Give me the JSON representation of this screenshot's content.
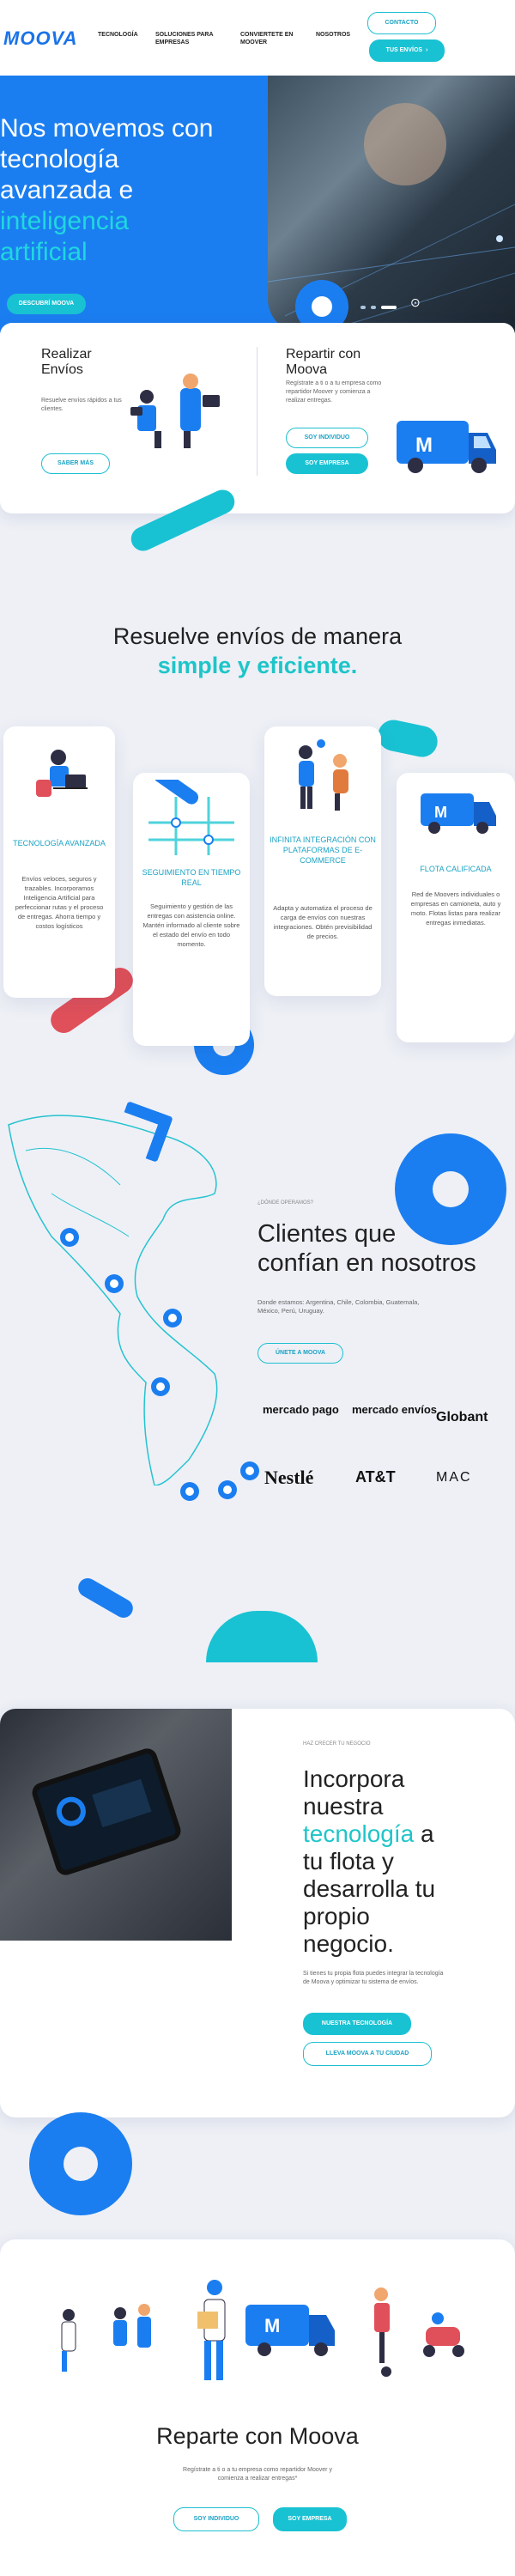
{
  "header": {
    "logo": "MOOVA",
    "nav": [
      "TECNOLOGÍA",
      "SOLUCIONES PARA EMPRESAS",
      "CONVIERTETE EN MOOVER",
      "NOSOTROS"
    ],
    "contact_label": "CONTACTO",
    "send_label": "TUS ENVÍOS"
  },
  "hero": {
    "title_line1": "Nos movemos con",
    "title_line2": "tecnología",
    "title_line3": "avanzada e",
    "title_line4": "inteligencia",
    "title_line5": "artificial",
    "cta": "DESCUBRÍ MOOVA"
  },
  "cards": {
    "left": {
      "title_line1": "Realizar",
      "title_line2": "Envíos",
      "desc": "Resuelve envíos rápidos a tus clientes.",
      "cta": "SABER MÁS"
    },
    "right": {
      "title_line1": "Repartir con",
      "title_line2": "Moova",
      "desc": "Regístrate a ti o a tu empresa como repartidor Moover y comienza a realizar entregas.",
      "btn1": "SOY INDIVIDUO",
      "btn2": "SOY EMPRESA"
    }
  },
  "resuelve": {
    "title": "Resuelve envíos de manera",
    "subtitle": "simple y eficiente."
  },
  "features": [
    {
      "title": "TECNOLOGÍA AVANZADA",
      "desc": "Envíos veloces, seguros y trazables. Incorporamos Inteligencia Artificial para perfeccionar rutas y el proceso de entregas. Ahorra tiempo y costos logísticos"
    },
    {
      "title": "SEGUIMIENTO EN TIEMPO REAL",
      "desc": "Seguimiento y gestión de las entregas con asistencia online. Mantén informado al cliente sobre el estado del envío en todo momento."
    },
    {
      "title": "INFINITA INTEGRACIÓN CON PLATAFORMAS DE E-COMMERCE",
      "desc": "Adapta y automatiza el proceso de carga de envíos con nuestras integraciones. Obtén previsibilidad de precios."
    },
    {
      "title": "FLOTA CALIFICADA",
      "desc": "Red de Moovers individuales o empresas en camioneta, auto y moto. Flotas listas para realizar entregas inmediatas."
    }
  ],
  "clients": {
    "kicker": "¿DÓNDE OPERAMOS?",
    "title_line1": "Clientes que",
    "title_line2": "confían en nosotros",
    "desc": "Donde estamos: Argentina, Chile, Colombia, Guatemala, México, Perú, Uruguay.",
    "cta": "ÚNETE A MOOVA",
    "brands": [
      "mercado pago",
      "mercado envíos",
      "Globant",
      "Nestlé",
      "AT&T",
      "MAC"
    ]
  },
  "incorpora": {
    "kicker": "HAZ CRECER TU NEGOCIO",
    "line1": "Incorpora",
    "line2": "nuestra",
    "line3a": "tecnología",
    "line3b": " a",
    "line4": "tu flota y",
    "line5": "desarrolla tu",
    "line6": "propio",
    "line7": "negocio.",
    "desc": "Si tienes tu propia flota puedes integrar la tecnología de Moova y optimizar tu sistema de envíos.",
    "btn1": "NUESTRA TECNOLOGÍA",
    "btn2": "LLEVA MOOVA A TU CIUDAD"
  },
  "reparte": {
    "title": "Reparte con Moova",
    "desc": "Regístrate a ti o a tu empresa como repartidor Moover y comienza a realizar entregas*",
    "btn1": "SOY INDIVIDUO",
    "btn2": "SOY EMPRESA"
  },
  "colors": {
    "brand_blue": "#1b7ef0",
    "accent_cyan": "#19c2d3",
    "accent_red": "#e0505a"
  }
}
